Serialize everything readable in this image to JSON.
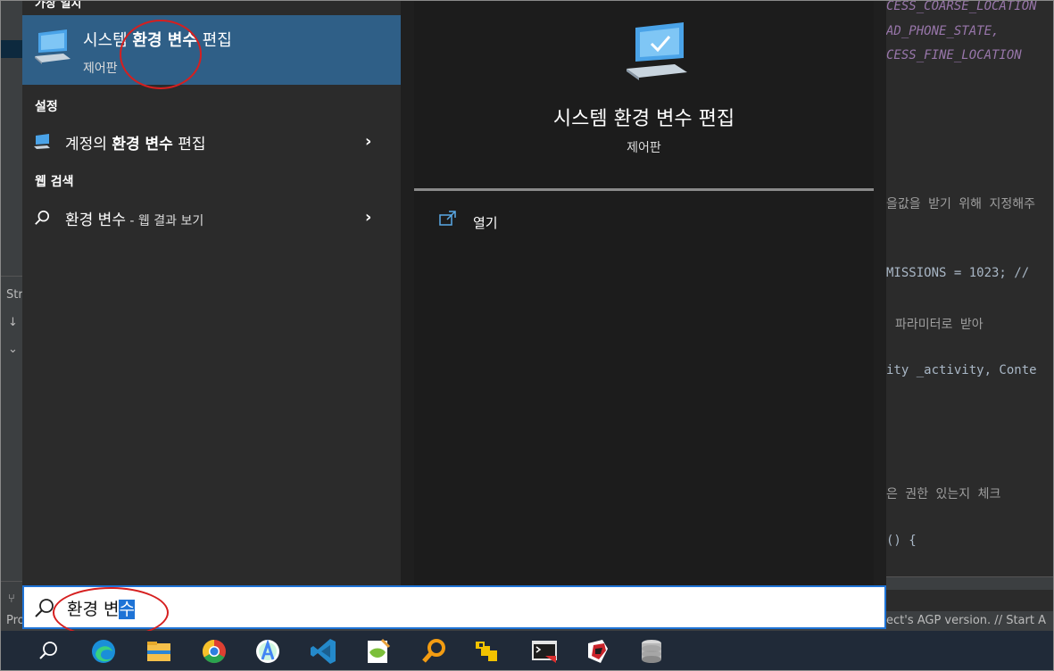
{
  "ide": {
    "left_labels": [
      "Str",
      "↓",
      "⌄",
      "Pro"
    ],
    "code_lines": [
      {
        "text": "CESS_COARSE_LOCATION",
        "kind": "perm"
      },
      {
        "text": "AD_PHONE_STATE,",
        "kind": "perm"
      },
      {
        "text": "CESS_FINE_LOCATION",
        "kind": "perm"
      },
      {
        "text": "을값을 받기 위해 지정해주",
        "kind": "comment"
      },
      {
        "text": "MISSIONS = 1023; //",
        "kind": "code"
      },
      {
        "text": "파라미터로 받아",
        "kind": "comment"
      },
      {
        "text": "ity _activity, Conte",
        "kind": "code"
      },
      {
        "text": "은 권한 있는지 체크",
        "kind": "comment"
      },
      {
        "text": "() {",
        "kind": "code"
      }
    ],
    "status_right": "ect's AGP version. // Start A"
  },
  "start_menu": {
    "best_match": {
      "section_label": "가장 일치",
      "title_pre": "시스템 ",
      "title_bold": "환경 변수",
      "title_post": " 편집",
      "subtitle": "제어판"
    },
    "settings_section": {
      "label": "설정",
      "item": {
        "pre": "계정의 ",
        "bold": "환경 변수",
        "post": " 편집"
      }
    },
    "web_section": {
      "label": "웹 검색",
      "item": {
        "text": "환경 변수",
        "suffix": " - 웹 결과 보기"
      }
    },
    "detail": {
      "title": "시스템 환경 변수 편집",
      "subtitle": "제어판",
      "open_label": "열기"
    }
  },
  "search": {
    "query_plain": "환경 변",
    "query_selected": "수"
  },
  "taskbar": {
    "items": [
      "search-icon",
      "edge-icon",
      "file-explorer-icon",
      "chrome-icon",
      "android-studio-icon",
      "vscode-icon",
      "notepad-plus-icon",
      "magnifier-search-icon",
      "yellow-app-icon",
      "terminal-icon",
      "ruby-app-icon",
      "database-icon"
    ]
  }
}
